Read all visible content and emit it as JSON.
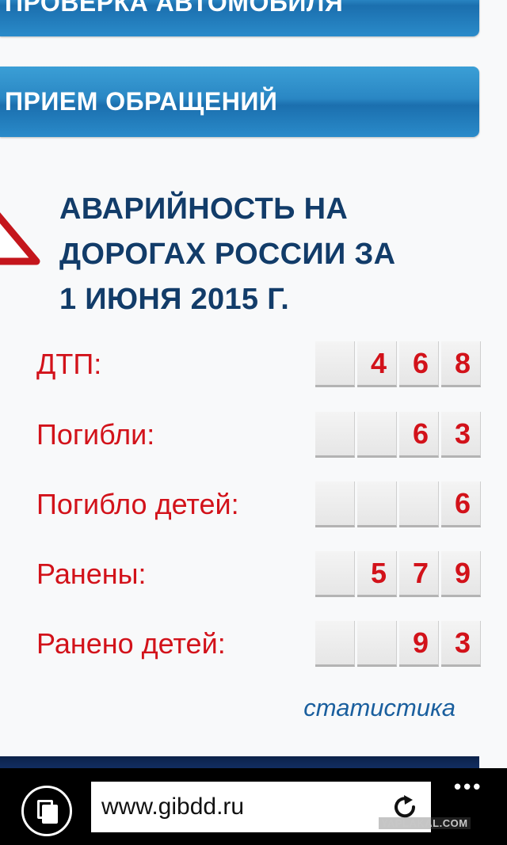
{
  "nav": {
    "check_vehicle": "ПРОВЕРКА АВТОМОБИЛЯ",
    "appeals": "ПРИЕМ ОБРАЩЕНИЙ"
  },
  "accidents": {
    "title_lines": [
      "АВАРИЙНОСТЬ НА",
      "ДОРОГАХ РОССИИ ЗА",
      "1 ИЮНЯ 2015 Г."
    ],
    "rows": [
      {
        "label": "ДТП:",
        "digits": [
          "",
          "4",
          "6",
          "8"
        ]
      },
      {
        "label": "Погибли:",
        "digits": [
          "",
          "",
          "6",
          "3"
        ]
      },
      {
        "label": "Погибло детей:",
        "digits": [
          "",
          "",
          "",
          "6"
        ]
      },
      {
        "label": "Ранены:",
        "digits": [
          "",
          "5",
          "7",
          "9"
        ]
      },
      {
        "label": "Ранено детей:",
        "digits": [
          "",
          "",
          "9",
          "3"
        ]
      }
    ],
    "stats_link": "статистика"
  },
  "browser": {
    "url": "www.gibdd.ru",
    "more": "•••",
    "watermark": "YAPLAKAL.COM"
  },
  "colors": {
    "heading": "#123c69",
    "stat_red": "#d2121a",
    "button_blue": "#2a87c4"
  }
}
